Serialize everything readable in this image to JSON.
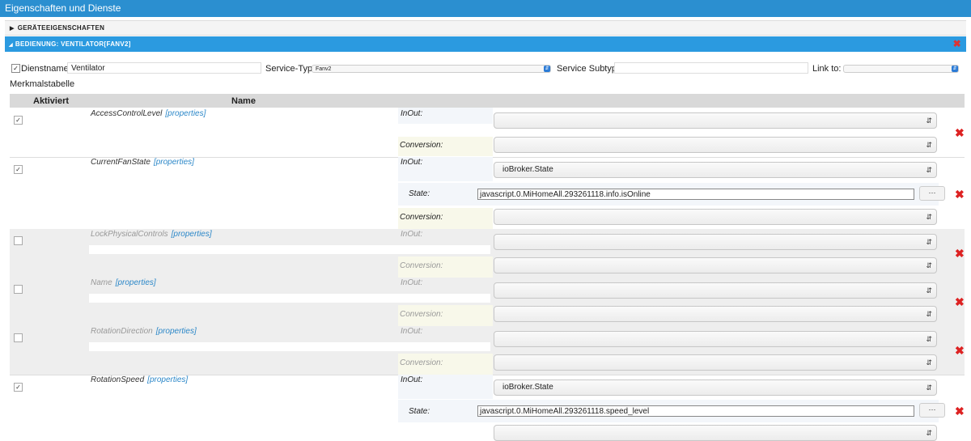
{
  "window": {
    "title": "Eigenschaften und Dienste"
  },
  "sections": {
    "device_props": "GERÄTEEIGENSCHAFTEN",
    "service": "BEDIENUNG: VENTILATOR[FANV2]"
  },
  "service": {
    "name_label": "Dienstname:",
    "name_value": "Ventilator",
    "type_label": "Service-Typ:",
    "type_value": "Fanv2",
    "subtype_label": "Service Subtyp:",
    "subtype_value": "",
    "link_label": "Link to:",
    "link_value": ""
  },
  "table": {
    "title": "Merkmalstabelle",
    "col_activated": "Aktiviert",
    "col_name": "Name",
    "props_link": "[properties]",
    "inout_label": "InOut:",
    "conversion_label": "Conversion:",
    "state_label": "State:",
    "dots": "···",
    "rows": [
      {
        "name": "AccessControlLevel",
        "checked": true,
        "inout": "",
        "state": null,
        "conversion": ""
      },
      {
        "name": "CurrentFanState",
        "checked": true,
        "inout": "ioBroker.State",
        "state": "javascript.0.MiHomeAll.293261118.info.isOnline",
        "conversion": ""
      },
      {
        "name": "LockPhysicalControls",
        "checked": false,
        "inout": "",
        "state": null,
        "conversion": ""
      },
      {
        "name": "Name",
        "checked": false,
        "inout": "",
        "state": null,
        "conversion": ""
      },
      {
        "name": "RotationDirection",
        "checked": false,
        "inout": "",
        "state": null,
        "conversion": ""
      },
      {
        "name": "RotationSpeed",
        "checked": true,
        "inout": "ioBroker.State",
        "state": "javascript.0.MiHomeAll.293261118.speed_level",
        "conversion": ""
      }
    ]
  }
}
